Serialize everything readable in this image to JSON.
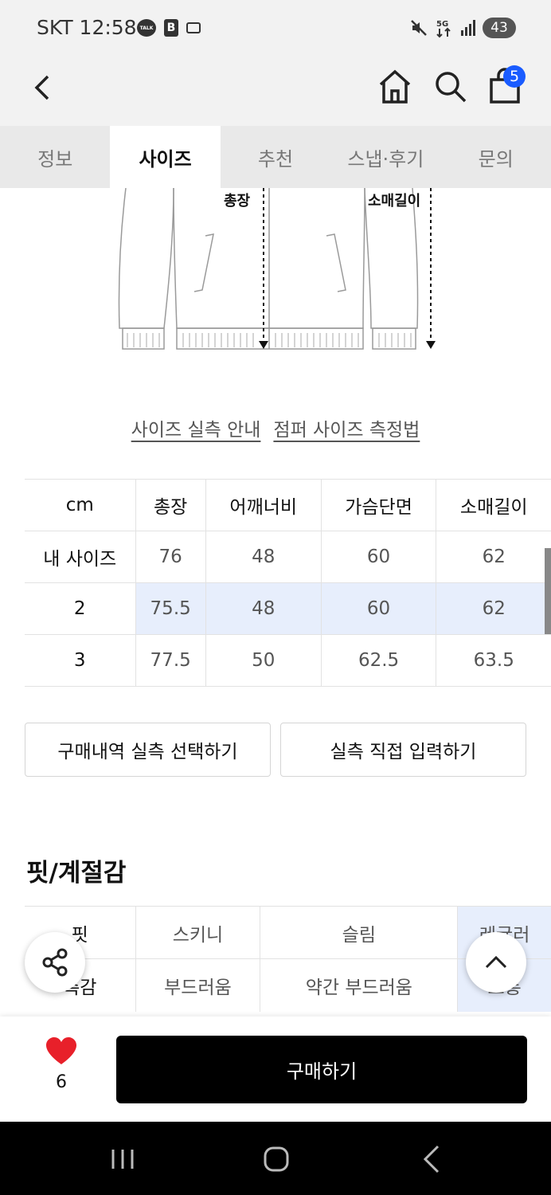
{
  "status_bar": {
    "carrier": "SKT",
    "time": "12:58",
    "talk_icon_text": "TALK",
    "b_icon_text": "B",
    "battery": "43"
  },
  "header": {
    "cart_count": "5"
  },
  "tabs": [
    {
      "label": "정보",
      "active": false
    },
    {
      "label": "사이즈",
      "active": true
    },
    {
      "label": "추천",
      "active": false
    },
    {
      "label": "스냅·후기",
      "active": false
    },
    {
      "label": "문의",
      "active": false
    }
  ],
  "diagram": {
    "label_length": "총장",
    "label_sleeve": "소매길이"
  },
  "guide_links": {
    "size_guide": "사이즈 실측 안내",
    "measure_method": "점퍼 사이즈 측정법"
  },
  "size_table": {
    "headers": [
      "cm",
      "총장",
      "어깨너비",
      "가슴단면",
      "소매길이"
    ],
    "rows": [
      {
        "label": "내 사이즈",
        "values": [
          "76",
          "48",
          "60",
          "62"
        ],
        "highlight": false
      },
      {
        "label": "2",
        "values": [
          "75.5",
          "48",
          "60",
          "62"
        ],
        "highlight": true
      },
      {
        "label": "3",
        "values": [
          "77.5",
          "50",
          "62.5",
          "63.5"
        ],
        "highlight": false
      }
    ]
  },
  "buttons": {
    "select_purchase": "구매내역 실측 선택하기",
    "manual_input": "실측 직접 입력하기"
  },
  "fit_section": {
    "title": "핏/계절감",
    "rows": [
      {
        "label": "핏",
        "options": [
          "스키니",
          "슬림",
          "레귤러"
        ],
        "selected": 2
      },
      {
        "label": "촉감",
        "options": [
          "부드러움",
          "약간 부드러움",
          "보통"
        ],
        "selected": 2
      }
    ]
  },
  "bottom_bar": {
    "like_count": "6",
    "buy_label": "구매하기"
  },
  "colors": {
    "accent_blue": "#1a5cff",
    "highlight": "#e7eefc",
    "heart": "#e8202a"
  }
}
